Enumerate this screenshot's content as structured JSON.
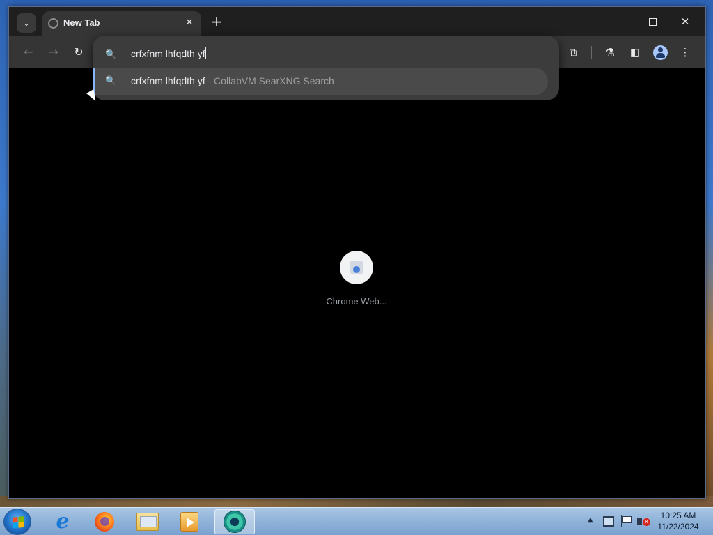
{
  "browser": {
    "tab": {
      "title": "New Tab",
      "close_glyph": "✕"
    },
    "tab_search_glyph": "⌄",
    "new_tab_glyph": "+",
    "window_controls": {
      "close_glyph": "✕"
    },
    "toolbar": {
      "back_glyph": "←",
      "forward_glyph": "→",
      "reload_glyph": "↻",
      "extensions_glyph": "⧉",
      "labs_glyph": "⚗",
      "side_panel_glyph": "◧",
      "menu_glyph": "⋮"
    },
    "omnibox": {
      "search_glyph": "🔍",
      "value": "crfxfnm lhfqdth yf",
      "suggestion": {
        "text": "crfxfnm lhfqdth yf",
        "separator": "-",
        "engine": "CollabVM SearXNG Search"
      }
    },
    "new_tab_page": {
      "shortcut_label": "Chrome Web..."
    }
  },
  "taskbar": {
    "apps": [
      "internet-explorer",
      "firefox",
      "file-explorer",
      "media-player",
      "chrome"
    ],
    "tray": {
      "arrow_glyph": "▲",
      "time": "10:25 AM",
      "date": "11/22/2024"
    }
  },
  "colors": {
    "accent": "#8ab4f8",
    "omnibox_bg": "#3c3c3c",
    "toolbar_bg": "#353535"
  }
}
